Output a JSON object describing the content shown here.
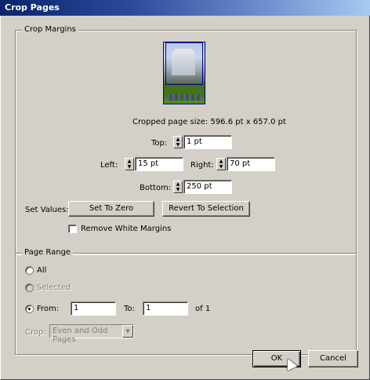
{
  "window": {
    "title": "Crop Pages"
  },
  "crop_margins": {
    "legend": "Crop Margins",
    "cropped_size_label": "Cropped page size: 596.6 pt x 657.0 pt",
    "top": {
      "label": "Top:",
      "value": "1 pt"
    },
    "left": {
      "label": "Left:",
      "value": "15 pt"
    },
    "right": {
      "label": "Right:",
      "value": "70 pt"
    },
    "bottom": {
      "label": "Bottom:",
      "value": "250 pt"
    },
    "set_values_label": "Set Values:",
    "set_to_zero_button": "Set To Zero",
    "revert_button": "Revert To Selection",
    "remove_white_margins_label": "Remove White Margins",
    "remove_white_margins_checked": false
  },
  "page_range": {
    "legend": "Page Range",
    "all_label": "All",
    "selected_label": "Selected",
    "from_label": "From:",
    "from_value": "1",
    "to_label": "To:",
    "to_value": "1",
    "of_label": "of 1",
    "crop_label": "Crop:",
    "crop_select": "Even and Odd Pages"
  },
  "buttons": {
    "ok": "OK",
    "cancel": "Cancel"
  }
}
